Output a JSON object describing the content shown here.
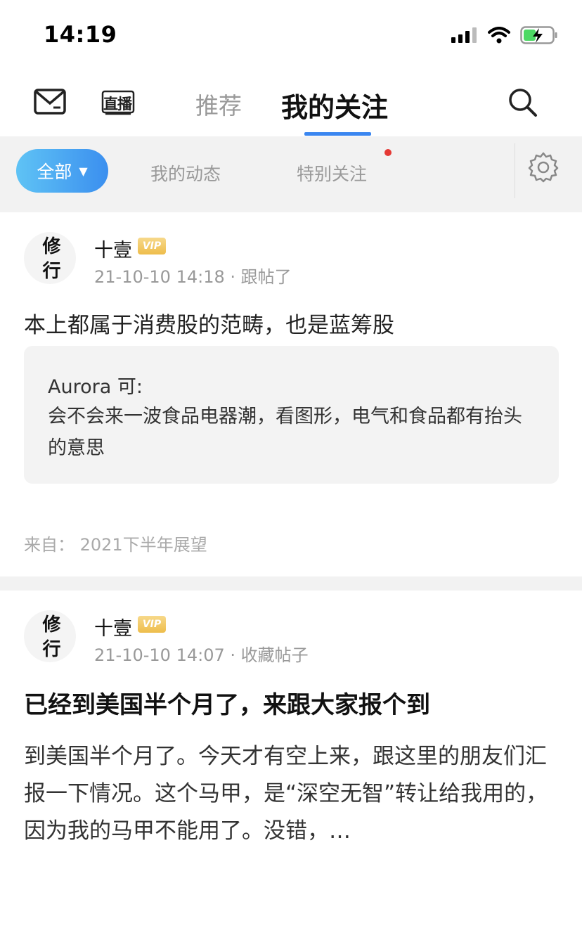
{
  "status_bar": {
    "time": "14:19"
  },
  "nav": {
    "live_label": "直播",
    "tabs": [
      {
        "label": "推荐",
        "active": false
      },
      {
        "label": "我的关注",
        "active": true
      }
    ],
    "accent_color": "#3a86f0"
  },
  "filters": {
    "all": "全部",
    "my_dynamic": "我的动态",
    "special_follow": "特别关注"
  },
  "posts": [
    {
      "user": "十壹",
      "badge": "VIP",
      "avatar_text": "修 行",
      "meta": "21-10-10 14:18 · 跟帖了",
      "body": "本上都属于消费股的范畴，也是蓝筹股",
      "quote_author": "Aurora 可:",
      "quote_text": "会不会来一波食品电器潮，看图形，电气和食品都有抬头的意思",
      "from": "来自：  2021下半年展望"
    },
    {
      "user": "十壹",
      "badge": "VIP",
      "avatar_text": "修 行",
      "meta": "21-10-10 14:07 · 收藏帖子",
      "title": "已经到美国半个月了，来跟大家报个到",
      "excerpt": "到美国半个月了。今天才有空上来，跟这里的朋友们汇报一下情况。这个马甲，是“深空无智”转让给我用的，因为我的马甲不能用了。没错，…"
    }
  ]
}
